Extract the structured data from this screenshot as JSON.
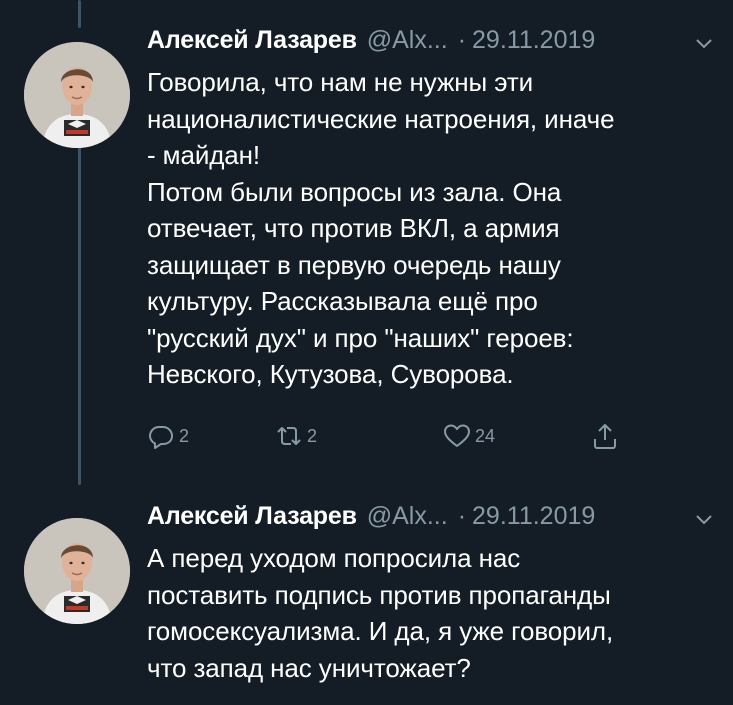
{
  "colors": {
    "background": "#141d26",
    "text_primary": "#ffffff",
    "text_secondary": "#8899a6",
    "thread_line": "#3d5466"
  },
  "tweets": [
    {
      "author_name": "Алексей Лазарев",
      "handle": "@Alx...",
      "separator": "·",
      "date": "29.11.2019",
      "caret_icon": "chevron-down-icon",
      "lines": [
        "Говорила, что нам не нужны эти",
        "националистические натроения, иначе",
        "- майдан!",
        "Потом были вопросы из зала. Она",
        "отвечает, что против ВКЛ, а армия",
        "защищает в первую очередь нашу",
        "культуру. Рассказывала ещё про",
        "\"русский дух\" и про \"наших\" героев:",
        "Невского, Кутузова, Суворова."
      ],
      "actions": {
        "reply_icon": "reply-icon",
        "reply_count": "2",
        "retweet_icon": "retweet-icon",
        "retweet_count": "2",
        "like_icon": "heart-icon",
        "like_count": "24",
        "share_icon": "share-icon"
      }
    },
    {
      "author_name": "Алексей Лазарев",
      "handle": "@Alx...",
      "separator": "·",
      "date": "29.11.2019",
      "caret_icon": "chevron-down-icon",
      "lines": [
        "А перед уходом попросила нас",
        "поставить подпись против пропаганды",
        "гомосексуализма. И да, я уже говорил,",
        "что запад нас уничтожает?"
      ]
    }
  ]
}
